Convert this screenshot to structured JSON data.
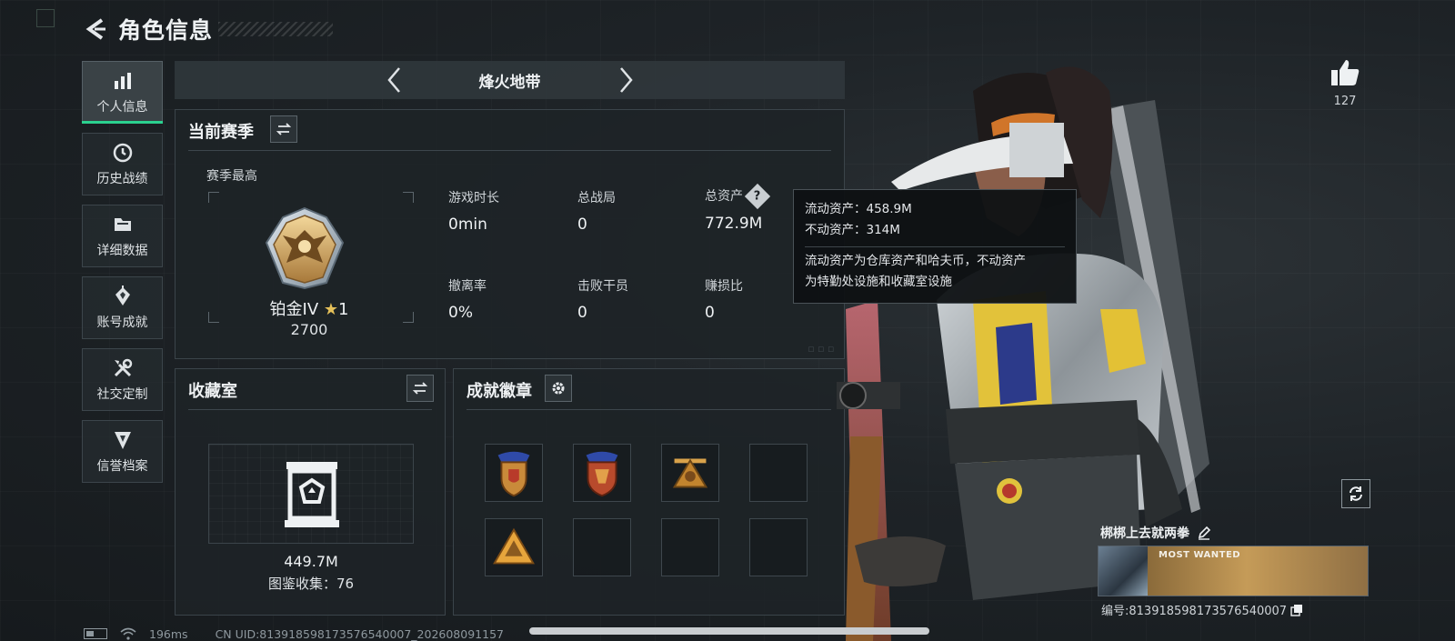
{
  "header": {
    "title": "角色信息"
  },
  "sidebar": {
    "items": [
      {
        "label": "个人信息",
        "icon": "bar-chart-icon",
        "active": true
      },
      {
        "label": "历史战绩",
        "icon": "history-icon"
      },
      {
        "label": "详细数据",
        "icon": "folder-icon"
      },
      {
        "label": "账号成就",
        "icon": "achievement-icon"
      },
      {
        "label": "社交定制",
        "icon": "tools-icon"
      },
      {
        "label": "信誉档案",
        "icon": "reputation-icon"
      }
    ]
  },
  "map_selector": {
    "name": "烽火地带"
  },
  "season": {
    "title": "当前赛季",
    "best_label": "赛季最高",
    "rank_name": "铂金IV",
    "rank_star": "★",
    "rank_star_count": "1",
    "rank_score": "2700",
    "stats": [
      {
        "label": "游戏时长",
        "value": "0min"
      },
      {
        "label": "总战局",
        "value": "0"
      },
      {
        "label": "总资产",
        "value": "772.9M"
      },
      {
        "label": "撤离率",
        "value": "0%"
      },
      {
        "label": "击败干员",
        "value": "0"
      },
      {
        "label": "赚损比",
        "value": "0"
      }
    ],
    "help_glyph": "?"
  },
  "tooltip": {
    "liquid": "流动资产：458.9M",
    "fixed": "不动资产：314M",
    "desc_line1": "流动资产为仓库资产和哈夫币，不动资产",
    "desc_line2": "为特勤处设施和收藏室设施"
  },
  "collection": {
    "title": "收藏室",
    "value": "449.7M",
    "count_text": "图鉴收集：76"
  },
  "badges": {
    "title": "成就徽章",
    "slots": [
      "shield-badge-blue",
      "shield-badge-red",
      "triangle-badge-gold",
      "empty",
      "triangle-badge-orange",
      "empty",
      "empty",
      "empty"
    ]
  },
  "profile": {
    "likes": "127",
    "player_name": "梆梆上去就两拳",
    "card_text": "MOST WANTED",
    "uid_label": "编号:813918598173576540007"
  },
  "status": {
    "ping": "196ms",
    "cn_uid": "CN UID:813918598173576540007_202608091157"
  },
  "colors": {
    "accent_green": "#2bd18f",
    "star_gold": "#e6c15a",
    "panel_bg": "#1e2327"
  }
}
